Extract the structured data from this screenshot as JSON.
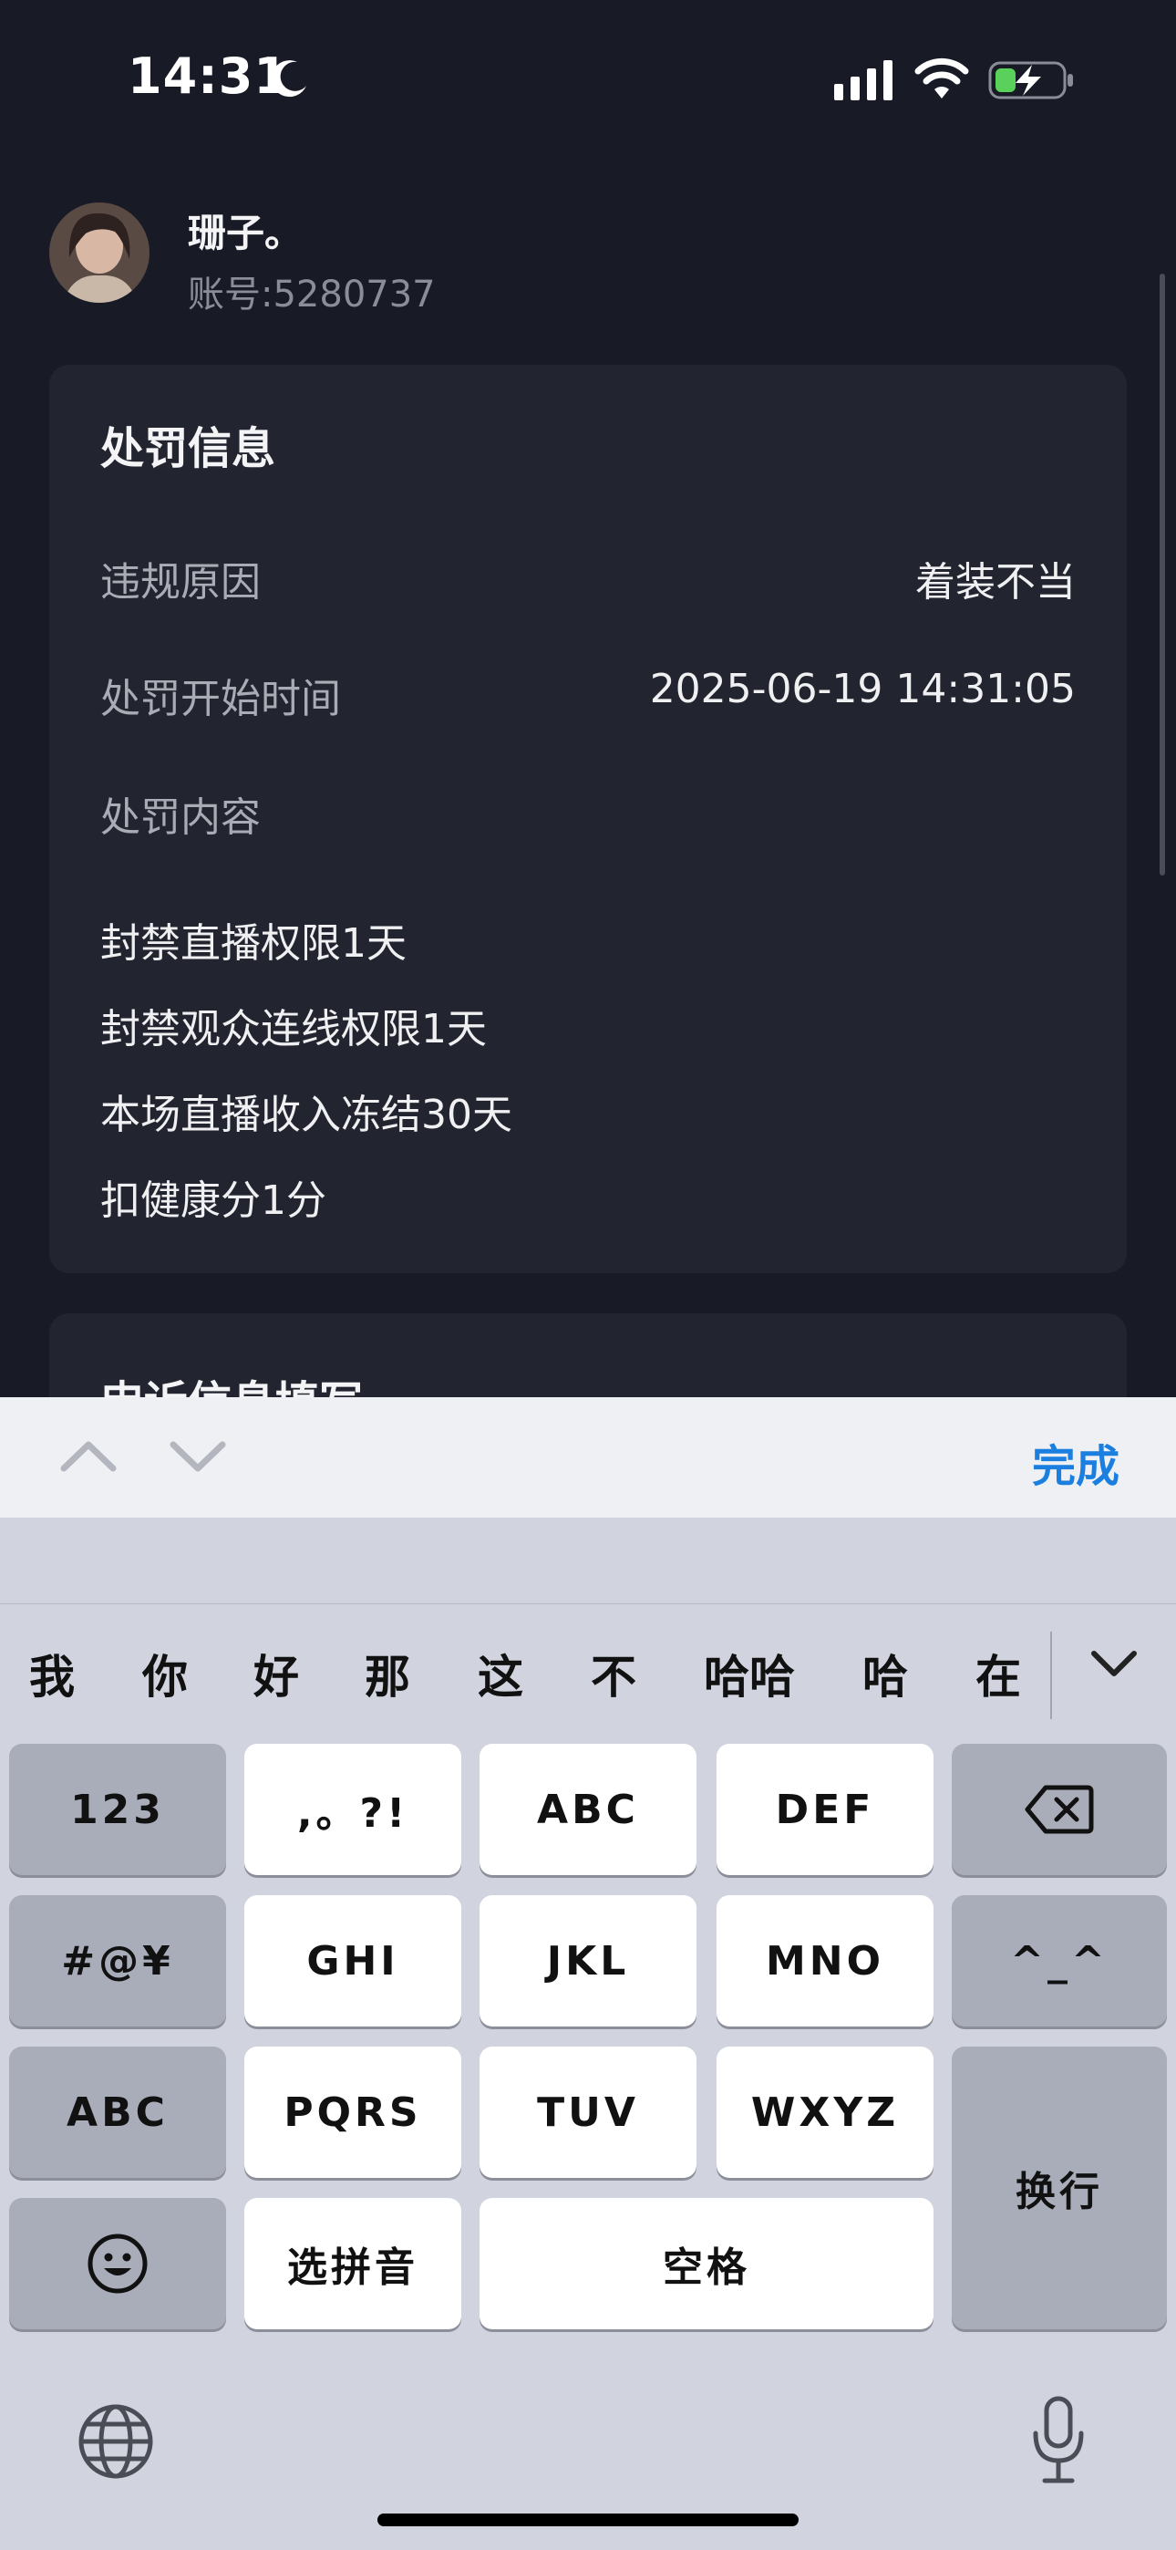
{
  "status_bar": {
    "time": "14:31"
  },
  "user": {
    "name": "珊子。",
    "account": "账号:5280737"
  },
  "penalty_card": {
    "title": "处罚信息",
    "rows": [
      {
        "label": "违规原因",
        "value": "着装不当"
      },
      {
        "label": "处罚开始时间",
        "value": "2025-06-19 14:31:05"
      },
      {
        "label": "处罚内容",
        "value": ""
      }
    ],
    "penalties": [
      "封禁直播权限1天",
      "封禁观众连线权限1天",
      "本场直播收入冻结30天",
      "扣健康分1分"
    ]
  },
  "appeal_card": {
    "title": "申诉信息填写"
  },
  "keyboard_accessory": {
    "done_label": "完成"
  },
  "candidates": [
    "我",
    "你",
    "好",
    "那",
    "这",
    "不",
    "哈哈",
    "哈",
    "在"
  ],
  "keys": {
    "k123": "123",
    "punct": ",。?!",
    "abc": "ABC",
    "def": "DEF",
    "symbols": "#@¥",
    "ghi": "GHI",
    "jkl": "JKL",
    "mno": "MNO",
    "emoticon": "^_^",
    "abc_switch": "ABC",
    "pqrs": "PQRS",
    "tuv": "TUV",
    "wxyz": "WXYZ",
    "return": "换行",
    "pinyin": "选拼音",
    "space": "空格"
  },
  "colors": {
    "background": "#181b26",
    "card": "#22252f",
    "accent": "#1b7fe0",
    "keyboard": "#d1d4de"
  }
}
